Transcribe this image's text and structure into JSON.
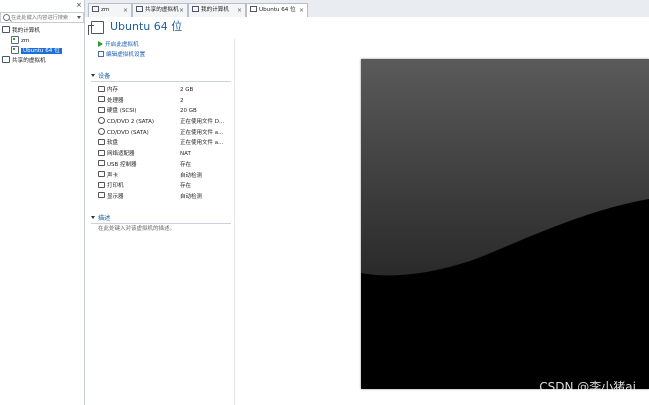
{
  "library": {
    "close_glyph": "×",
    "search_placeholder": "在此处键入内容进行搜索",
    "tree": {
      "my_computer": "我的计算机",
      "vm_zm": "zm",
      "vm_ubuntu": "Ubuntu 64 位",
      "shared": "共享的虚拟机"
    }
  },
  "tabs": [
    {
      "label": "zm",
      "close": "×"
    },
    {
      "label": "共享的虚拟机",
      "close": "×"
    },
    {
      "label": "我的计算机",
      "close": "×"
    },
    {
      "label": "Ubuntu 64 位",
      "close": "×"
    }
  ],
  "vm": {
    "title": "Ubuntu 64 位",
    "actions": {
      "power_on": "开启此虚拟机",
      "edit_settings": "编辑虚拟机设置"
    },
    "devices_header": "设备",
    "devices": [
      {
        "name": "内存",
        "value": "2 GB",
        "icon": "memory-icon"
      },
      {
        "name": "处理器",
        "value": "2",
        "icon": "cpu-icon"
      },
      {
        "name": "硬盘 (SCSI)",
        "value": "20 GB",
        "icon": "disk-icon"
      },
      {
        "name": "CD/DVD 2 (SATA)",
        "value": "正在使用文件 D...",
        "icon": "cd-icon"
      },
      {
        "name": "CD/DVD (SATA)",
        "value": "正在使用文件 a...",
        "icon": "cd-icon"
      },
      {
        "name": "软盘",
        "value": "正在使用文件 a...",
        "icon": "floppy-icon"
      },
      {
        "name": "网络适配器",
        "value": "NAT",
        "icon": "network-icon"
      },
      {
        "name": "USB 控制器",
        "value": "存在",
        "icon": "usb-icon"
      },
      {
        "name": "声卡",
        "value": "自动检测",
        "icon": "sound-icon"
      },
      {
        "name": "打印机",
        "value": "存在",
        "icon": "printer-icon"
      },
      {
        "name": "显示器",
        "value": "自动检测",
        "icon": "monitor-icon"
      }
    ],
    "description_header": "描述",
    "description_placeholder": "在此处键入对该虚拟机的描述。"
  },
  "watermark": "CSDN @李小猪ai"
}
